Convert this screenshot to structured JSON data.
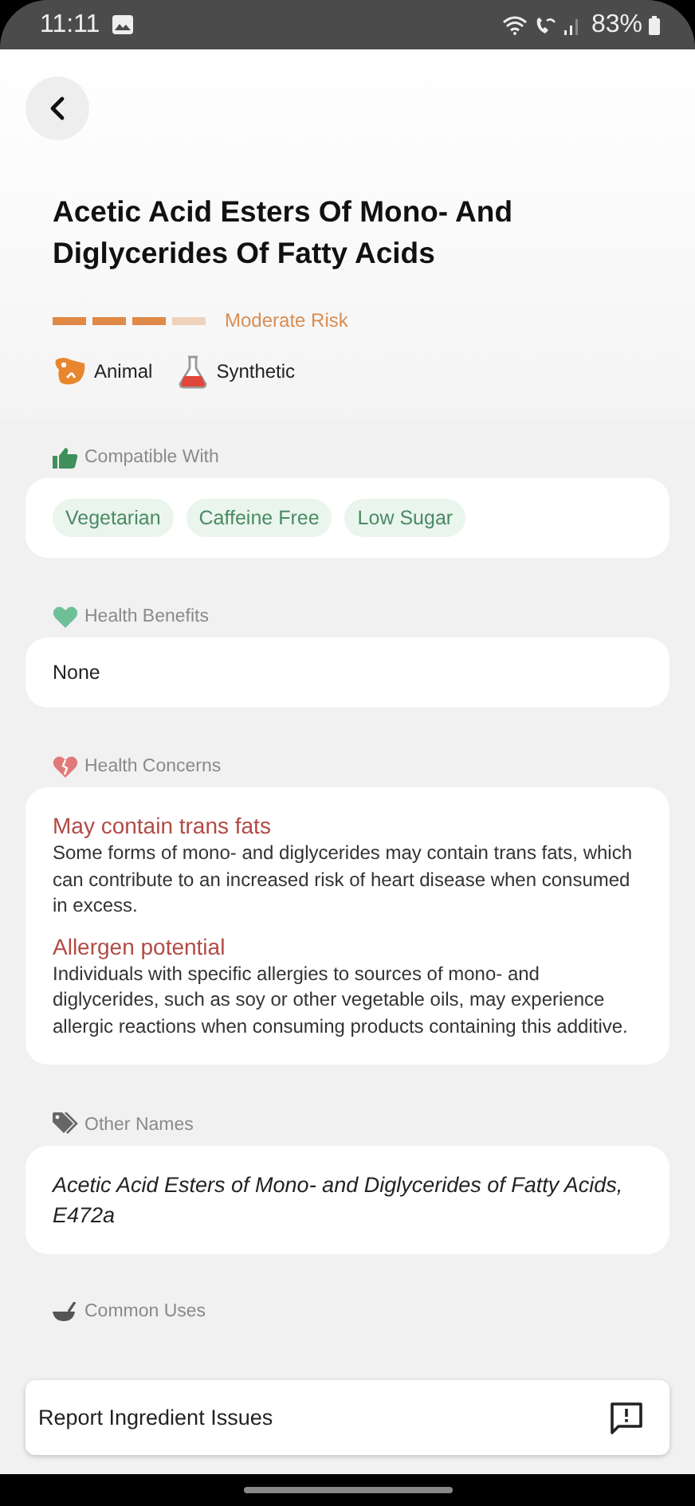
{
  "status_bar": {
    "time": "11:11",
    "battery": "83%"
  },
  "ingredient": {
    "title": "Acetic Acid Esters Of Mono- And Diglycerides Of Fatty Acids",
    "risk": {
      "level": 0.75,
      "label": "Moderate Risk"
    },
    "origins": [
      {
        "kind": "animal",
        "label": "Animal"
      },
      {
        "kind": "synthetic",
        "label": "Synthetic"
      }
    ]
  },
  "sections": [
    {
      "kind": "tags",
      "heading": "Compatible With",
      "tags": [
        "Vegetarian",
        "Caffeine Free",
        "Low Sugar"
      ]
    },
    {
      "kind": "text",
      "heading": "Health Benefits",
      "text": "None"
    },
    {
      "kind": "concerns",
      "heading": "Health Concerns",
      "items": [
        {
          "title": "May contain trans fats",
          "text": "Some forms of mono- and diglycerides may contain trans fats, which can contribute to an increased risk of heart disease when consumed in excess."
        },
        {
          "title": "Allergen potential",
          "text": "Individuals with specific allergies to sources of mono- and diglycerides, such as soy or other vegetable oils, may experience allergic reactions when consuming products containing this additive."
        }
      ]
    },
    {
      "kind": "names",
      "heading": "Other Names",
      "text": "Acetic Acid Esters of Mono- and Diglycerides of Fatty Acids, E472a"
    },
    {
      "kind": "heading_only",
      "heading": "Common Uses"
    }
  ],
  "report_bar": {
    "label": "Report Ingredient Issues"
  }
}
